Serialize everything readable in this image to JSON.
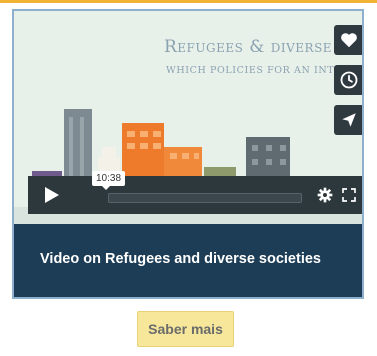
{
  "video": {
    "thumbnail_title": "Refugees & diverse societies",
    "thumbnail_subtitle": "which policies for an intercultural",
    "time": "10:38",
    "progress": 0.0,
    "caption": "Video on Refugees and diverse societies"
  },
  "icons": {
    "like": "heart-icon",
    "watch_later": "clock-icon",
    "share": "paper-plane-icon",
    "play": "play-icon",
    "settings": "gear-icon",
    "fullscreen": "fullscreen-icon"
  },
  "cta": {
    "label": "Saber mais"
  },
  "colors": {
    "accent_bar": "#f2b233",
    "caption_bg": "#1d3d56",
    "controls_bg": "#2d383c",
    "button_bg": "#f6e79a"
  }
}
